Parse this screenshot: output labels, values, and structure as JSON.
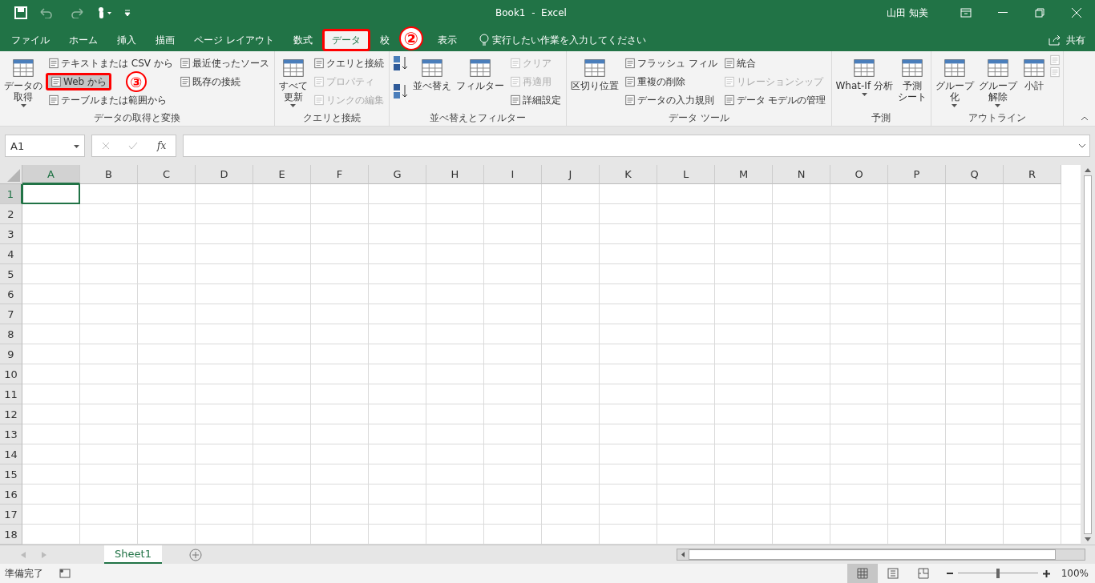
{
  "title_bar": {
    "title": "Book1  -  Excel",
    "user": "山田 知美"
  },
  "tabs": [
    {
      "label": "ファイル",
      "selected": false,
      "highlighted": false
    },
    {
      "label": "ホーム",
      "selected": false,
      "highlighted": false
    },
    {
      "label": "挿入",
      "selected": false,
      "highlighted": false
    },
    {
      "label": "描画",
      "selected": false,
      "highlighted": false
    },
    {
      "label": "ページ レイアウト",
      "selected": false,
      "highlighted": false
    },
    {
      "label": "数式",
      "selected": false,
      "highlighted": false
    },
    {
      "label": "データ",
      "selected": true,
      "highlighted": true,
      "callout": "②"
    },
    {
      "label": "校",
      "selected": false,
      "highlighted": false
    },
    {
      "label": "表示",
      "selected": false,
      "highlighted": false
    }
  ],
  "tell_me": {
    "placeholder": "実行したい作業を入力してください"
  },
  "share": "共有",
  "ribbon_groups": [
    {
      "label": "データの取得と変換",
      "items": [
        {
          "kind": "large",
          "lines": [
            "データの",
            "取得"
          ],
          "dropdown": true,
          "disabled": false
        },
        {
          "kind": "stack",
          "items": [
            {
              "label": "テキストまたは CSV から",
              "disabled": false,
              "highlighted": false
            },
            {
              "label": "Web から",
              "disabled": false,
              "highlighted": true,
              "callout": "③"
            },
            {
              "label": "テーブルまたは範囲から",
              "disabled": false,
              "highlighted": false
            }
          ]
        },
        {
          "kind": "stack",
          "items": [
            {
              "label": "最近使ったソース",
              "disabled": false,
              "highlighted": false
            },
            {
              "label": "既存の接続",
              "disabled": false,
              "highlighted": false
            }
          ]
        }
      ]
    },
    {
      "label": "クエリと接続",
      "items": [
        {
          "kind": "large",
          "lines": [
            "すべて",
            "更新"
          ],
          "dropdown": true,
          "disabled": false
        },
        {
          "kind": "stack",
          "items": [
            {
              "label": "クエリと接続",
              "disabled": false,
              "highlighted": false
            },
            {
              "label": "プロパティ",
              "disabled": true,
              "highlighted": false
            },
            {
              "label": "リンクの編集",
              "disabled": true,
              "highlighted": false
            }
          ]
        }
      ]
    },
    {
      "label": "並べ替えとフィルター",
      "items": [
        {
          "kind": "sort"
        },
        {
          "kind": "large",
          "lines": [
            "並べ替え"
          ],
          "dropdown": false,
          "disabled": false
        },
        {
          "kind": "large",
          "lines": [
            "フィルター"
          ],
          "dropdown": false,
          "disabled": false
        },
        {
          "kind": "stack",
          "items": [
            {
              "label": "クリア",
              "disabled": true,
              "highlighted": false
            },
            {
              "label": "再適用",
              "disabled": true,
              "highlighted": false
            },
            {
              "label": "詳細設定",
              "disabled": false,
              "highlighted": false
            }
          ]
        }
      ]
    },
    {
      "label": "データ ツール",
      "items": [
        {
          "kind": "large",
          "lines": [
            "区切り位置"
          ],
          "dropdown": false,
          "disabled": false
        },
        {
          "kind": "stack",
          "items": [
            {
              "label": "フラッシュ フィル",
              "disabled": false,
              "highlighted": false
            },
            {
              "label": "重複の削除",
              "disabled": false,
              "highlighted": false
            },
            {
              "label": "データの入力規則",
              "disabled": false,
              "highlighted": false
            }
          ]
        },
        {
          "kind": "stack",
          "items": [
            {
              "label": "統合",
              "disabled": false,
              "highlighted": false
            },
            {
              "label": "リレーションシップ",
              "disabled": true,
              "highlighted": false
            },
            {
              "label": "データ モデルの管理",
              "disabled": false,
              "highlighted": false
            }
          ]
        }
      ]
    },
    {
      "label": "予測",
      "items": [
        {
          "kind": "large",
          "lines": [
            "What-If 分析"
          ],
          "dropdown": true,
          "disabled": false
        },
        {
          "kind": "large",
          "lines": [
            "予測",
            "シート"
          ],
          "dropdown": false,
          "disabled": false
        }
      ]
    },
    {
      "label": "アウトライン",
      "items": [
        {
          "kind": "large",
          "lines": [
            "グループ",
            "化"
          ],
          "dropdown": true,
          "disabled": false
        },
        {
          "kind": "large",
          "lines": [
            "グループ",
            "解除"
          ],
          "dropdown": true,
          "disabled": false
        },
        {
          "kind": "large",
          "lines": [
            "小計"
          ],
          "dropdown": false,
          "disabled": false
        },
        {
          "kind": "detail"
        }
      ]
    }
  ],
  "name_box": "A1",
  "formula_bar": {
    "fx": "fx"
  },
  "columns": [
    {
      "label": "A",
      "selected": true
    },
    {
      "label": "B",
      "selected": false
    },
    {
      "label": "C",
      "selected": false
    },
    {
      "label": "D",
      "selected": false
    },
    {
      "label": "E",
      "selected": false
    },
    {
      "label": "F",
      "selected": false
    },
    {
      "label": "G",
      "selected": false
    },
    {
      "label": "H",
      "selected": false
    },
    {
      "label": "I",
      "selected": false
    },
    {
      "label": "J",
      "selected": false
    },
    {
      "label": "K",
      "selected": false
    },
    {
      "label": "L",
      "selected": false
    },
    {
      "label": "M",
      "selected": false
    },
    {
      "label": "N",
      "selected": false
    },
    {
      "label": "O",
      "selected": false
    },
    {
      "label": "P",
      "selected": false
    },
    {
      "label": "Q",
      "selected": false
    },
    {
      "label": "R",
      "selected": false
    }
  ],
  "rows": [
    {
      "label": "1",
      "selected": true
    },
    {
      "label": "2",
      "selected": false
    },
    {
      "label": "3",
      "selected": false
    },
    {
      "label": "4",
      "selected": false
    },
    {
      "label": "5",
      "selected": false
    },
    {
      "label": "6",
      "selected": false
    },
    {
      "label": "7",
      "selected": false
    },
    {
      "label": "8",
      "selected": false
    },
    {
      "label": "9",
      "selected": false
    },
    {
      "label": "10",
      "selected": false
    },
    {
      "label": "11",
      "selected": false
    },
    {
      "label": "12",
      "selected": false
    },
    {
      "label": "13",
      "selected": false
    },
    {
      "label": "14",
      "selected": false
    },
    {
      "label": "15",
      "selected": false
    },
    {
      "label": "16",
      "selected": false
    },
    {
      "label": "17",
      "selected": false
    },
    {
      "label": "18",
      "selected": false
    }
  ],
  "sheets": [
    {
      "label": "Sheet1",
      "selected": true
    }
  ],
  "status": {
    "text": "準備完了",
    "zoom": "100%",
    "zoom_slider": {
      "level": 0.5
    },
    "views": [
      {
        "kind": "normal",
        "selected": true
      },
      {
        "kind": "layout",
        "selected": false
      },
      {
        "kind": "pagebreak",
        "selected": false
      }
    ]
  }
}
